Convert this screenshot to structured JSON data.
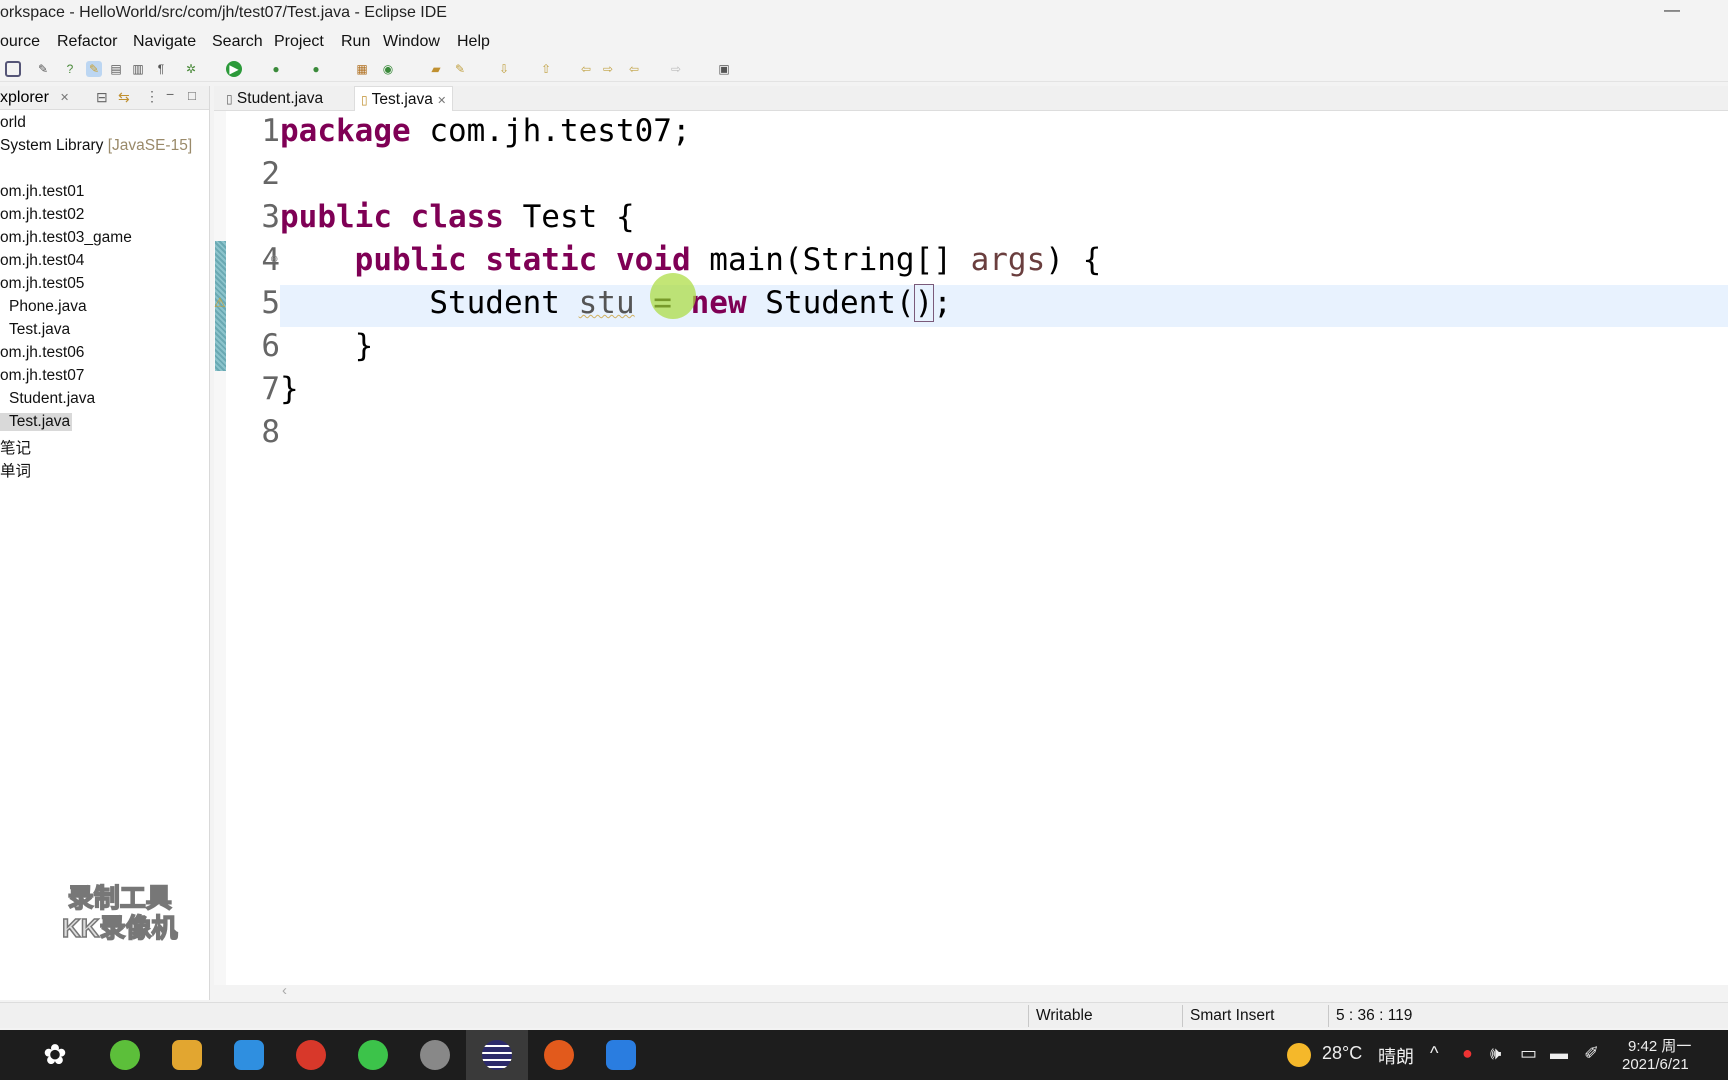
{
  "window": {
    "title": "orkspace - HelloWorld/src/com/jh/test07/Test.java - Eclipse IDE",
    "minimize": "—"
  },
  "menu": [
    "ource",
    "Refactor",
    "Navigate",
    "Search",
    "Project",
    "Run",
    "Window",
    "Help"
  ],
  "sidebar": {
    "tab_label": "xplorer",
    "close": "✕",
    "items": [
      {
        "label": "orld"
      },
      {
        "label": "System Library",
        "suffix": "[JavaSE-15]"
      },
      {
        "label": "om.jh.test01"
      },
      {
        "label": "om.jh.test02"
      },
      {
        "label": "om.jh.test03_game"
      },
      {
        "label": "om.jh.test04"
      },
      {
        "label": "om.jh.test05"
      },
      {
        "label": "Phone.java"
      },
      {
        "label": "Test.java"
      },
      {
        "label": "om.jh.test06"
      },
      {
        "label": "om.jh.test07"
      },
      {
        "label": "Student.java"
      },
      {
        "label": "Test.java",
        "selected": true
      },
      {
        "label": "笔记"
      },
      {
        "label": "单词"
      }
    ]
  },
  "editor": {
    "tabs": [
      {
        "label": "Student.java"
      },
      {
        "label": "Test.java",
        "active": true,
        "close": "✕"
      }
    ],
    "line_numbers": [
      "1",
      "2",
      "3",
      "4",
      "5",
      "6",
      "7",
      "8"
    ],
    "tokens": {
      "package": "package",
      "pkg": " com.jh.test07;",
      "public": "public",
      "class": "class",
      "test": " Test {",
      "static": "static",
      "void": "void",
      "main": " main(String[] ",
      "args": "args",
      ") {": ") {",
      "student": "Student ",
      "stu": "stu",
      "eq": " = ",
      "new": "new",
      "ctor": " Student(",
      "paren": ")",
      "semi": ";",
      "close1": "}",
      "close2": "}"
    },
    "current_line": 5
  },
  "status": {
    "writable": "Writable",
    "insert_mode": "Smart Insert",
    "position": "5 : 36 : 119"
  },
  "watermark": {
    "line1": "录制工具",
    "line2": "KK录像机"
  },
  "taskbar": {
    "weather_temp": "28°C",
    "weather_text": "晴朗",
    "time": "9:42 周一",
    "date": "2021/6/21",
    "apps": [
      {
        "icon": "fan-icon",
        "color": "#ffffff"
      },
      {
        "icon": "browser-icon",
        "color": "#5cbf3a"
      },
      {
        "icon": "vm-icon",
        "color": "#e2a630"
      },
      {
        "icon": "search-app-icon",
        "color": "#2f8fe0"
      },
      {
        "icon": "snail-icon",
        "color": "#d8382a"
      },
      {
        "icon": "wechat-icon",
        "color": "#3cc34a"
      },
      {
        "icon": "game-icon",
        "color": "#888888"
      },
      {
        "icon": "eclipse-icon",
        "color": "#2c2a6a"
      },
      {
        "icon": "cat-icon",
        "color": "#e25a1c"
      },
      {
        "icon": "wps-icon",
        "color": "#2a7de0"
      }
    ]
  }
}
